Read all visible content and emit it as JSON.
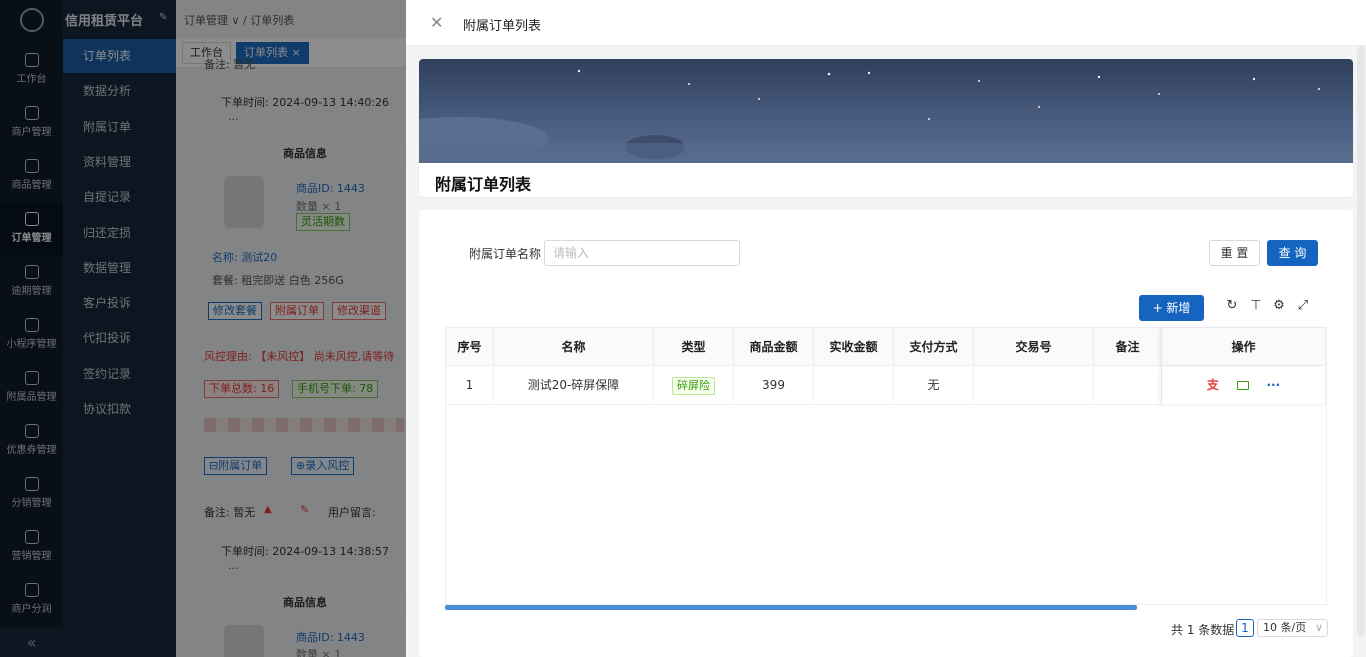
{
  "rail": {
    "items": [
      {
        "label": "工作台",
        "icon": "home-icon"
      },
      {
        "label": "商户管理",
        "icon": "bag-icon"
      },
      {
        "label": "商品管理",
        "icon": "apple-icon"
      },
      {
        "label": "订单管理",
        "icon": "trophy-icon"
      },
      {
        "label": "逾期管理",
        "icon": "alarm-icon"
      },
      {
        "label": "小程序管理",
        "icon": "watch-icon"
      },
      {
        "label": "附属品管理",
        "icon": "cart-icon"
      },
      {
        "label": "优惠券管理",
        "icon": "gift-icon"
      },
      {
        "label": "分销管理",
        "icon": "chart-icon"
      },
      {
        "label": "营销管理",
        "icon": "megaphone-icon"
      },
      {
        "label": "商户分润",
        "icon": "coin-icon"
      }
    ],
    "collapse": "«"
  },
  "submenu": {
    "brand": "信用租赁平台",
    "items": [
      "订单列表",
      "数据分析",
      "附属订单",
      "资料管理",
      "自提记录",
      "归还定损",
      "数据管理",
      "客户投诉",
      "代扣投诉",
      "签约记录",
      "协议扣款"
    ]
  },
  "main": {
    "breadcrumb": "订单管理 ∨ / 订单列表",
    "tabs": [
      "工作台",
      "订单列表"
    ],
    "top_partial": "备注: 暂无",
    "order1": {
      "time": "下单时间: 2024-09-13 14:40:26",
      "dots": "...",
      "header": "商品信息",
      "product_id": "商品ID: 1443",
      "qty": "数量 × 1",
      "badge": "灵活期数",
      "name": "名称: 测试20",
      "package": "套餐: 租完即送 白色 256G",
      "btn_modify_pkg": "修改套餐",
      "btn_sub_order": "附属订单",
      "btn_modify_channel": "修改渠道",
      "risk": "风控理由: 【未风控】 尚未风控,请等待",
      "stat_total": "下单总数: 16",
      "stat_phone": "手机号下单: 78",
      "btn_sub_order2": "附属订单",
      "btn_risk": "录入风控",
      "note": "备注: 暂无",
      "msg": "用户留言:"
    },
    "order2": {
      "time": "下单时间: 2024-09-13 14:38:57",
      "dots": "...",
      "header": "商品信息",
      "product_id": "商品ID: 1443",
      "qty": "数量 × 1"
    }
  },
  "drawer": {
    "title": "附属订单列表",
    "banner_title": "附属订单列表",
    "search": {
      "label": "附属订单名称",
      "placeholder": "请输入",
      "reset": "重 置",
      "query": "查 询"
    },
    "add_button": "+ 新增",
    "toolbar_icons": [
      "refresh-icon",
      "column-height-icon",
      "settings-icon",
      "fullscreen-icon"
    ],
    "table": {
      "columns": [
        "序号",
        "名称",
        "类型",
        "商品金额",
        "实收金额",
        "支付方式",
        "交易号",
        "备注",
        "操作"
      ],
      "rows": [
        {
          "index": "1",
          "name": "测试20-碎屏保障",
          "type": "碎屏险",
          "amount": "399",
          "received": "",
          "pay": "无",
          "trade_no": "",
          "remark": ""
        }
      ],
      "actions": [
        "alipay-icon",
        "card-icon",
        "more-icon"
      ]
    },
    "pagination": {
      "total": "共 1 条数据",
      "page": "1",
      "size": "10 条/页"
    }
  },
  "colors": {
    "primary": "#1565c0",
    "sidebar": "#111c2b",
    "submenu_active": "#1d5fa6",
    "danger": "#e53935",
    "success": "#389e0d"
  }
}
